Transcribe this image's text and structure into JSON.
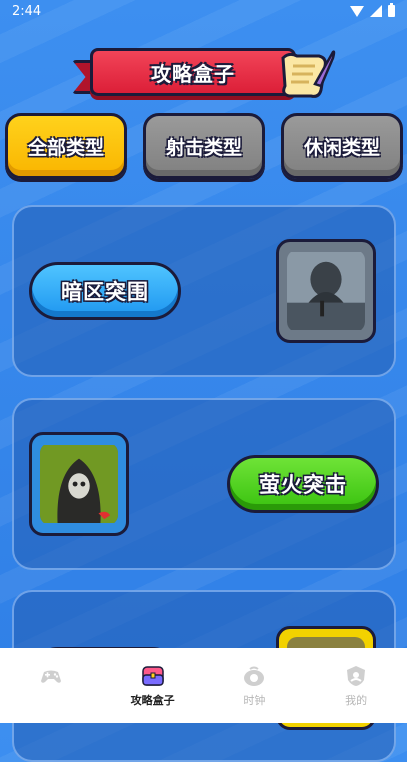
{
  "status_bar": {
    "time": "2:44"
  },
  "header": {
    "title": "攻略盒子"
  },
  "categories": [
    {
      "label": "全部类型",
      "active": true
    },
    {
      "label": "射击类型",
      "active": false
    },
    {
      "label": "休闲类型",
      "active": false
    }
  ],
  "games": [
    {
      "name": "暗区突围",
      "button_color": "blue",
      "icon_frame": "gray"
    },
    {
      "name": "萤火突击",
      "button_color": "green",
      "icon_frame": "blue"
    },
    {
      "name": "",
      "button_color": "",
      "icon_frame": "yellow"
    }
  ],
  "bottom_nav": [
    {
      "label": "",
      "icon": "gamepad-icon",
      "active": false
    },
    {
      "label": "攻略盒子",
      "icon": "box-icon",
      "active": true
    },
    {
      "label": "时钟",
      "icon": "clock-icon",
      "active": false
    },
    {
      "label": "我的",
      "icon": "profile-icon",
      "active": false
    }
  ],
  "colors": {
    "background": "#3d8ff0",
    "active_tab": "#ffd21c",
    "inactive_tab": "#8c8c8c",
    "banner": "#e52c42"
  }
}
